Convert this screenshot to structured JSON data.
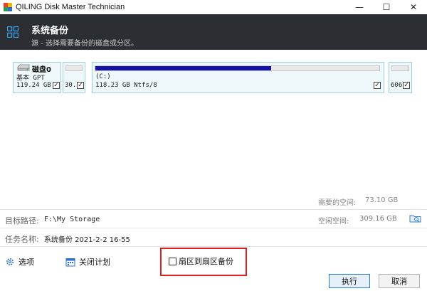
{
  "window": {
    "title": "QILING Disk Master Technician",
    "controls": [
      "—",
      "☐",
      "✕"
    ]
  },
  "header": {
    "title": "系统备份",
    "subtitle": "源 - 选择需要备份的磁盘或分区。"
  },
  "disk": {
    "name": "磁盘0",
    "type": "基本 GPT",
    "size": "119.24 GB",
    "checked": true
  },
  "partitions": [
    {
      "label": "30.",
      "checked": true,
      "fill": 0.0
    },
    {
      "label": "(C:)",
      "info": "118.23 GB Ntfs/8",
      "checked": true,
      "fill": 0.62
    },
    {
      "label": "606",
      "checked": true,
      "fill": 0.0
    }
  ],
  "required_space": {
    "label": "需要的空间:",
    "value": "73.10 GB"
  },
  "destination": {
    "label": "目标路径:",
    "value": "F:\\My Storage"
  },
  "free_space": {
    "label": "空闲空间:",
    "value": "309.16 GB"
  },
  "task": {
    "label": "任务名称:",
    "value": "系统备份 2021-2-2 16-55"
  },
  "options": {
    "options_label": "选项",
    "schedule_label": "关闭计划",
    "sector_label": "扇区到扇区备份"
  },
  "buttons": {
    "execute": "执行",
    "cancel": "取消"
  },
  "colors": {
    "header_bg": "#2b2e33",
    "highlight": "#e02020",
    "bar_fill": "#1313a8",
    "partition_bg": "#eef8fb"
  }
}
